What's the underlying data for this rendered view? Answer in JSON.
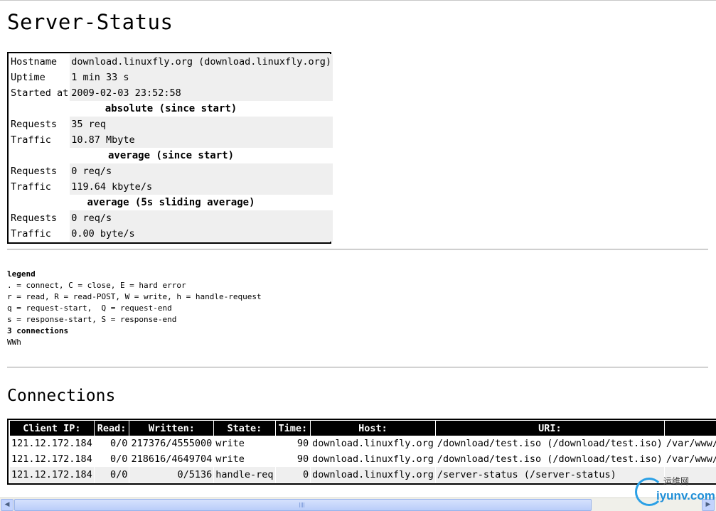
{
  "page_title": "Server-Status",
  "status": {
    "rows": [
      {
        "key": "Hostname",
        "value": "download.linuxfly.org (download.linuxfly.org)"
      },
      {
        "key": "Uptime",
        "value": "1 min 33 s"
      },
      {
        "key": "Started at",
        "value": "2009-02-03 23:52:58"
      }
    ],
    "absolute_header": "absolute (since start)",
    "absolute": [
      {
        "key": "Requests",
        "value": "35 req"
      },
      {
        "key": "Traffic",
        "value": "10.87 Mbyte"
      }
    ],
    "average_header": "average (since start)",
    "average": [
      {
        "key": "Requests",
        "value": "0 req/s"
      },
      {
        "key": "Traffic",
        "value": "119.64 kbyte/s"
      }
    ],
    "sliding_header": "average (5s sliding average)",
    "sliding": [
      {
        "key": "Requests",
        "value": "0 req/s"
      },
      {
        "key": "Traffic",
        "value": "0.00 byte/s"
      }
    ]
  },
  "legend": {
    "title": "legend",
    "lines": [
      ". = connect, C = close, E = hard error",
      "r = read, R = read-POST, W = write, h = handle-request",
      "q = request-start,  Q = request-end",
      "s = response-start, S = response-end"
    ],
    "connections_count": "3 connections",
    "states": "WWh"
  },
  "connections": {
    "title": "Connections",
    "headers": [
      "Client IP:",
      "Read:",
      "Written:",
      "State:",
      "Time:",
      "Host:",
      "URI:",
      ""
    ],
    "rows": [
      [
        "121.12.172.184",
        "0/0",
        "217376/4555000",
        "write",
        "90",
        "download.linuxfly.org",
        "/download/test.iso (/download/test.iso)",
        "/var/www/htm"
      ],
      [
        "121.12.172.184",
        "0/0",
        "218616/4649704",
        "write",
        "90",
        "download.linuxfly.org",
        "/download/test.iso (/download/test.iso)",
        "/var/www/htm"
      ],
      [
        "121.12.172.184",
        "0/0",
        "0/5136",
        "handle-req",
        "0",
        "download.linuxfly.org",
        "/server-status (/server-status)",
        ""
      ]
    ]
  },
  "scrollbar": {
    "left_arrow": "◀",
    "right_arrow": "▶"
  },
  "watermark": {
    "cn": "运维网",
    "url": "iyunv.com"
  }
}
